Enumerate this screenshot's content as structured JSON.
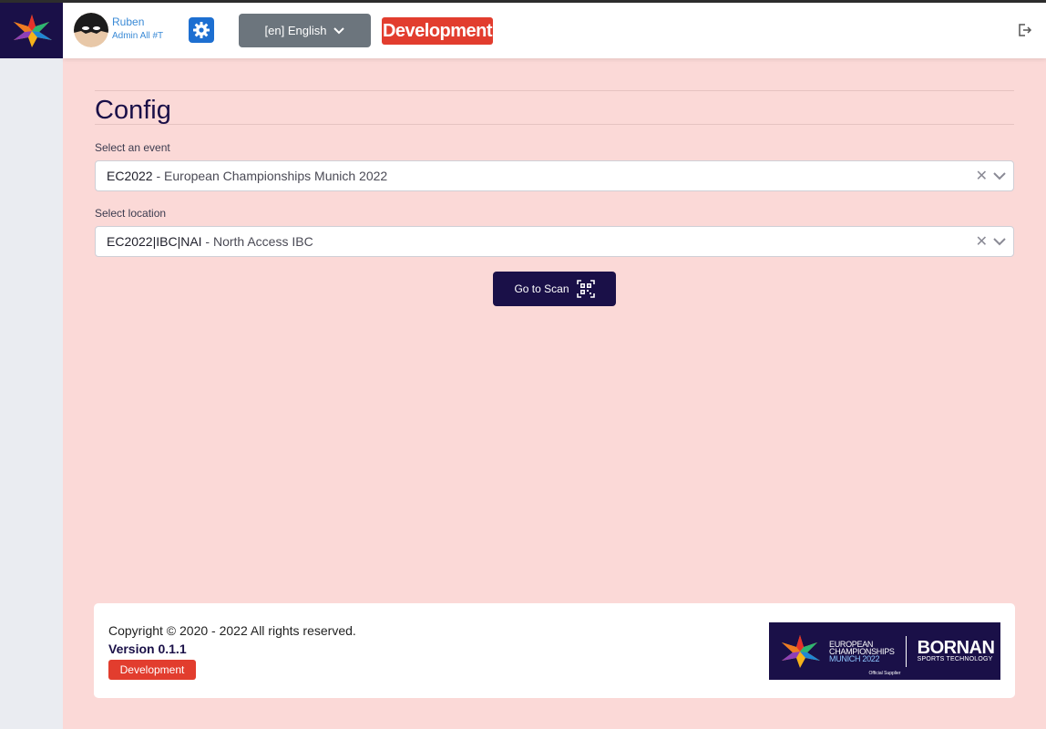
{
  "header": {
    "user_name": "Ruben",
    "user_role": "Admin All #T",
    "language_label": "[en] English",
    "env_badge": "Development"
  },
  "page": {
    "title": "Config"
  },
  "event_select": {
    "label": "Select an event",
    "code": "EC2022",
    "name": " - European Championships Munich 2022"
  },
  "location_select": {
    "label": "Select location",
    "code": "EC2022|IBC|NAI",
    "name": " - North Access IBC"
  },
  "scan_button": {
    "label": "Go to Scan"
  },
  "footer": {
    "copyright": "Copyright © 2020 - 2022 All rights reserved.",
    "version": "Version 0.1.1",
    "env_badge": "Development",
    "sponsor": {
      "line1": "EUROPEAN",
      "line2": "CHAMPIONSHIPS",
      "line3": "MUNICH 2022",
      "brand": "BORNAN",
      "brand_sub": "SPORTS TECHNOLOGY",
      "official": "Official Supplier"
    }
  },
  "colors": {
    "brand_navy": "#1a1048",
    "content_bg": "#fbd9d7",
    "danger": "#e23d2e",
    "link_blue": "#3a8ad6",
    "secondary": "#6c757d"
  },
  "icons": {
    "logo": "star-logo-icon",
    "settings": "gear-icon",
    "dropdown": "chevron-down-icon",
    "clear": "close-icon",
    "scan": "qr-code-icon",
    "logout": "logout-icon"
  }
}
